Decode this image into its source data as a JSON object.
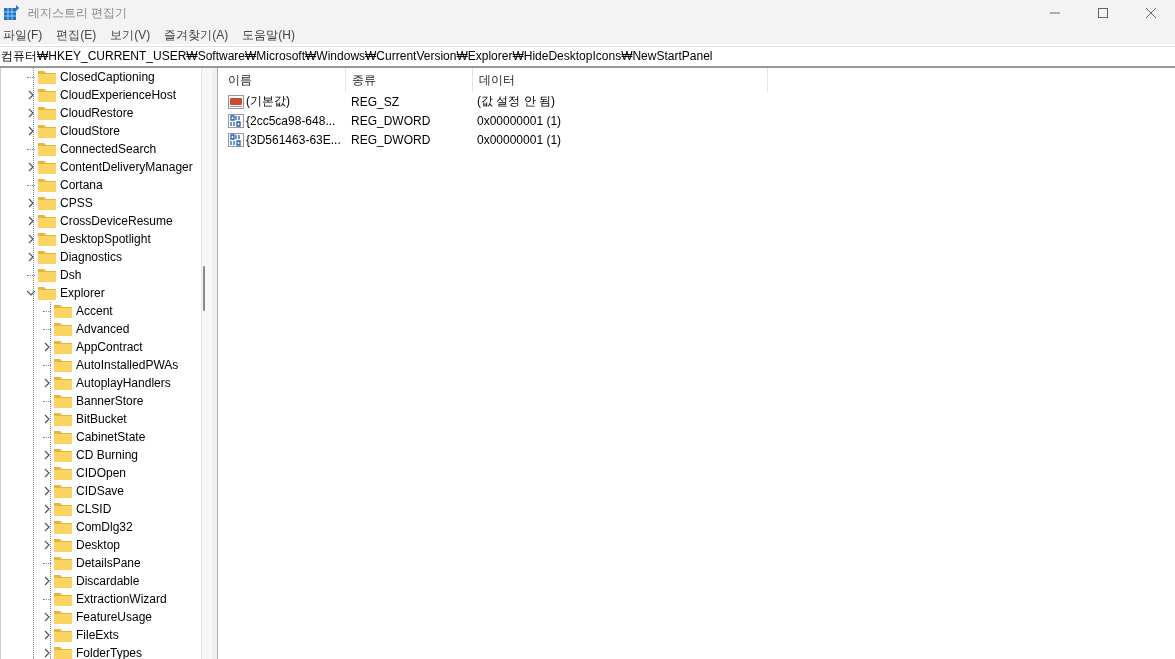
{
  "window": {
    "title": "레지스트리 편집기"
  },
  "menu": [
    "파일(F)",
    "편집(E)",
    "보기(V)",
    "즐겨찾기(A)",
    "도움말(H)"
  ],
  "address": "컴퓨터₩HKEY_CURRENT_USER₩Software₩Microsoft₩Windows₩CurrentVersion₩Explorer₩HideDesktopIcons₩NewStartPanel",
  "tree": [
    {
      "label": "ClosedCaptioning",
      "expandable": false,
      "expanded": false
    },
    {
      "label": "CloudExperienceHost",
      "expandable": true,
      "expanded": false
    },
    {
      "label": "CloudRestore",
      "expandable": true,
      "expanded": false
    },
    {
      "label": "CloudStore",
      "expandable": true,
      "expanded": false
    },
    {
      "label": "ConnectedSearch",
      "expandable": false,
      "expanded": false
    },
    {
      "label": "ContentDeliveryManager",
      "expandable": true,
      "expanded": false
    },
    {
      "label": "Cortana",
      "expandable": false,
      "expanded": false
    },
    {
      "label": "CPSS",
      "expandable": true,
      "expanded": false
    },
    {
      "label": "CrossDeviceResume",
      "expandable": true,
      "expanded": false
    },
    {
      "label": "DesktopSpotlight",
      "expandable": true,
      "expanded": false
    },
    {
      "label": "Diagnostics",
      "expandable": true,
      "expanded": false
    },
    {
      "label": "Dsh",
      "expandable": false,
      "expanded": false
    },
    {
      "label": "Explorer",
      "expandable": true,
      "expanded": true,
      "children": [
        {
          "label": "Accent",
          "expandable": false,
          "expanded": false
        },
        {
          "label": "Advanced",
          "expandable": false,
          "expanded": false
        },
        {
          "label": "AppContract",
          "expandable": true,
          "expanded": false
        },
        {
          "label": "AutoInstalledPWAs",
          "expandable": false,
          "expanded": false
        },
        {
          "label": "AutoplayHandlers",
          "expandable": true,
          "expanded": false
        },
        {
          "label": "BannerStore",
          "expandable": false,
          "expanded": false
        },
        {
          "label": "BitBucket",
          "expandable": true,
          "expanded": false
        },
        {
          "label": "CabinetState",
          "expandable": false,
          "expanded": false
        },
        {
          "label": "CD Burning",
          "expandable": true,
          "expanded": false
        },
        {
          "label": "CIDOpen",
          "expandable": true,
          "expanded": false
        },
        {
          "label": "CIDSave",
          "expandable": true,
          "expanded": false
        },
        {
          "label": "CLSID",
          "expandable": true,
          "expanded": false
        },
        {
          "label": "ComDlg32",
          "expandable": true,
          "expanded": false
        },
        {
          "label": "Desktop",
          "expandable": true,
          "expanded": false
        },
        {
          "label": "DetailsPane",
          "expandable": false,
          "expanded": false
        },
        {
          "label": "Discardable",
          "expandable": true,
          "expanded": false
        },
        {
          "label": "ExtractionWizard",
          "expandable": false,
          "expanded": false
        },
        {
          "label": "FeatureUsage",
          "expandable": true,
          "expanded": false
        },
        {
          "label": "FileExts",
          "expandable": true,
          "expanded": false
        },
        {
          "label": "FolderTypes",
          "expandable": true,
          "expanded": false
        }
      ]
    }
  ],
  "values": {
    "columns": [
      "이름",
      "종류",
      "데이터"
    ],
    "rows": [
      {
        "kind": "string",
        "name": "(기본값)",
        "type": "REG_SZ",
        "data": "(값 설정 안 됨)"
      },
      {
        "kind": "binary",
        "name": "{2cc5ca98-648...",
        "type": "REG_DWORD",
        "data": "0x00000001 (1)"
      },
      {
        "kind": "binary",
        "name": "{3D561463-63E...",
        "type": "REG_DWORD",
        "data": "0x00000001 (1)"
      }
    ]
  }
}
